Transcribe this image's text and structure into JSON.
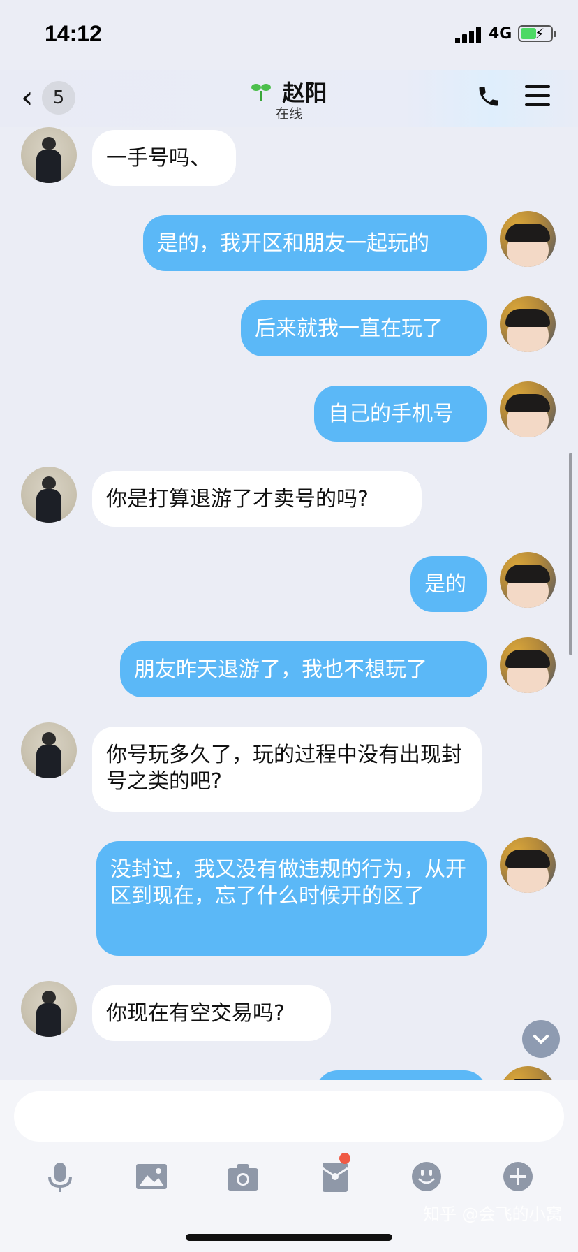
{
  "status": {
    "time": "14:12",
    "network": "4G"
  },
  "header": {
    "back_count": "5",
    "title": "赵阳",
    "subtitle": "在线"
  },
  "messages": [
    {
      "side": "in",
      "text": "一手号吗、"
    },
    {
      "side": "out",
      "text": "是的，我开区和朋友一起玩的"
    },
    {
      "side": "out",
      "text": "后来就我一直在玩了"
    },
    {
      "side": "out",
      "text": "自己的手机号"
    },
    {
      "side": "in",
      "text": "你是打算退游了才卖号的吗?"
    },
    {
      "side": "out",
      "text": "是的"
    },
    {
      "side": "out",
      "text": "朋友昨天退游了，我也不想玩了"
    },
    {
      "side": "in",
      "text": "你号玩多久了，玩的过程中没有出现封号之类的吧?"
    },
    {
      "side": "out",
      "text": "没封过，我又没有做违规的行为，从开区到现在，忘了什么时候开的区了"
    },
    {
      "side": "in",
      "text": "你现在有空交易吗?"
    }
  ],
  "toolbar": {
    "icons": [
      "microphone-icon",
      "image-icon",
      "camera-icon",
      "red-packet-icon",
      "emoji-icon",
      "plus-icon"
    ],
    "red_packet_badge": true
  },
  "watermark": "知乎 @会飞的小窝",
  "colors": {
    "outgoing_bubble": "#5bb8f7",
    "incoming_bubble": "#ffffff",
    "background": "#ebedf5",
    "badge_dot": "#f05a45"
  }
}
